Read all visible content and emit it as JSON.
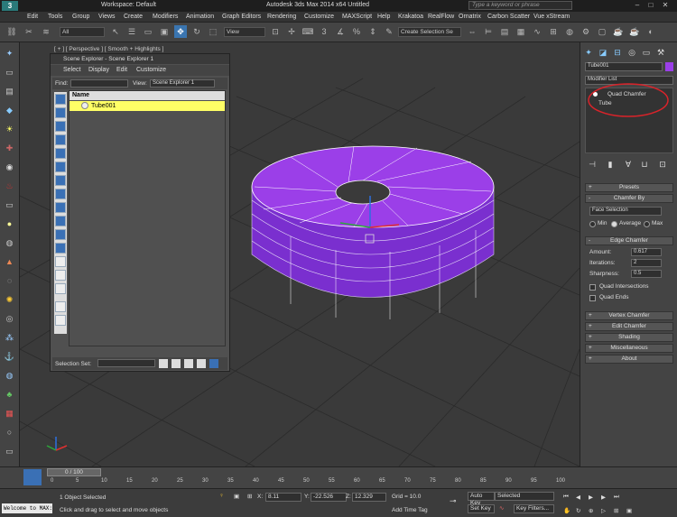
{
  "titlebar": {
    "workspace": "Workspace: Default",
    "title": "Autodesk 3ds Max  2014 x64      Untitled",
    "search_placeholder": "Type a keyword or phrase"
  },
  "menu": [
    "Edit",
    "Tools",
    "Group",
    "Views",
    "Create",
    "Modifiers",
    "Animation",
    "Graph Editors",
    "Rendering",
    "Customize",
    "MAXScript",
    "Help",
    "Krakatoa",
    "RealFlow",
    "Ornatrix",
    "Carbon Scatter",
    "Vue xStream"
  ],
  "toolbar": {
    "selection_filter": "All",
    "ref_coord": "View",
    "named_selection": "Create Selection Se"
  },
  "viewport": {
    "label": "[ + ] [ Perspective ] [ Smooth + Highlights ]"
  },
  "scene_explorer": {
    "title": "Scene Explorer - Scene Explorer 1",
    "menu": [
      "Select",
      "Display",
      "Edit",
      "Customize"
    ],
    "find_label": "Find:",
    "view_label": "View:",
    "view_value": "Scene Explorer 1",
    "column_header": "Name",
    "rows": [
      "Tube001"
    ],
    "selection_set_label": "Selection Set:"
  },
  "command_panel": {
    "object_name": "Tube001",
    "modifier_list": "Modifier List",
    "stack": [
      "Quad Chamfer",
      "Tube"
    ],
    "rollouts": {
      "presets": "Presets",
      "chamfer_by": "Chamfer By",
      "chamfer_by_value": "Face Selection",
      "radio_min": "Min",
      "radio_average": "Average",
      "radio_max": "Max",
      "edge_chamfer": "Edge Chamfer",
      "amount_label": "Amount:",
      "amount_value": "0.617",
      "iterations_label": "Iterations:",
      "iterations_value": "2",
      "sharpness_label": "Sharpness:",
      "sharpness_value": "0.5",
      "quad_intersections": "Quad Intersections",
      "quad_ends": "Quad Ends",
      "vertex_chamfer": "Vertex Chamfer",
      "edit_chamfer": "Edit Chamfer",
      "shading": "Shading",
      "miscellaneous": "Miscellaneous",
      "about": "About"
    }
  },
  "timeline": {
    "frame": "0 / 100",
    "ticks": [
      "0",
      "5",
      "10",
      "15",
      "20",
      "25",
      "30",
      "35",
      "40",
      "45",
      "50",
      "55",
      "60",
      "65",
      "70",
      "75",
      "80",
      "85",
      "90",
      "95",
      "100"
    ]
  },
  "status": {
    "welcome": "Welcome to MAX:",
    "selected": "1 Object Selected",
    "prompt": "Click and drag to select and move objects",
    "x_label": "X:",
    "x": "8.11",
    "y_label": "Y:",
    "y": "-22.526",
    "z_label": "Z:",
    "z": "12.329",
    "grid": "Grid = 10.0",
    "add_time_tag": "Add Time Tag",
    "auto_key": "Auto Key",
    "set_key": "Set Key",
    "selected_dd": "Selected",
    "key_filters": "Key Filters..."
  },
  "colors": {
    "object": "#9b3fe8",
    "selected_row": "#ffff66",
    "annotation": "#d9232a"
  }
}
